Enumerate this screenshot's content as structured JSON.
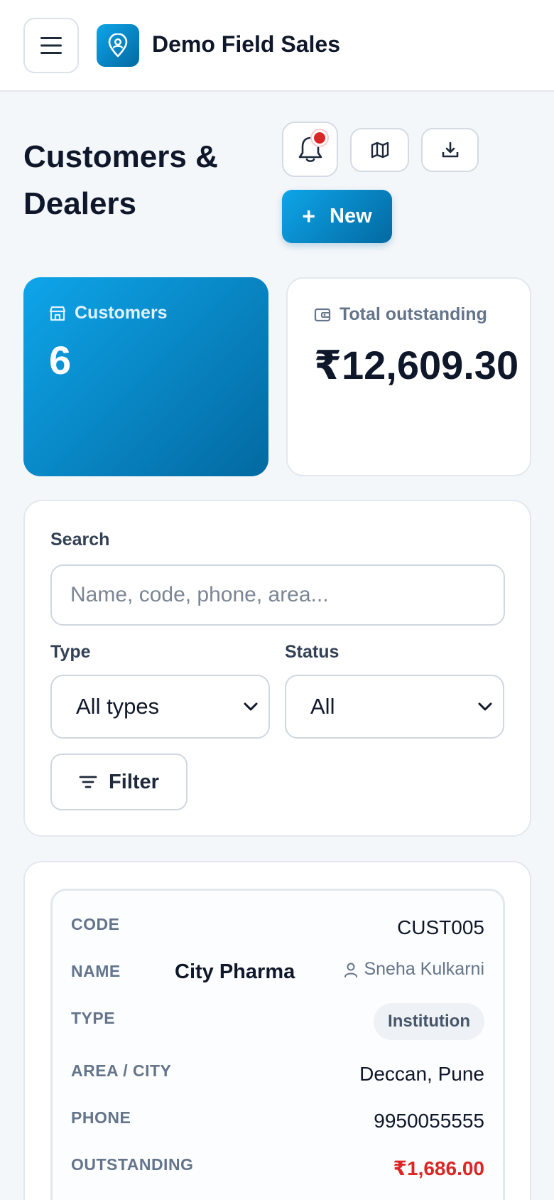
{
  "app": {
    "brand_name": "Demo Field Sales",
    "brand_icon": "map-pin-icon",
    "accent_color": "#0284c7"
  },
  "header": {
    "title": "Customers & Dealers",
    "new_label": "New",
    "notification_badge_color": "#dc2626"
  },
  "stats": {
    "customers_label": "Customers",
    "customers_value": "6",
    "outstanding_label": "Total outstanding",
    "outstanding_value": "₹12,609.30"
  },
  "filters": {
    "search_label": "Search",
    "search_placeholder": "Name, code, phone, area...",
    "type_label": "Type",
    "type_value": "All types",
    "status_label": "Status",
    "status_value": "All",
    "filter_label": "Filter"
  },
  "customer": {
    "labels": {
      "code": "CODE",
      "name": "NAME",
      "type": "TYPE",
      "area_city": "AREA / CITY",
      "phone": "PHONE",
      "outstanding": "OUTSTANDING"
    },
    "code": "CUST005",
    "name": "City Pharma",
    "owner": "Sneha Kulkarni",
    "type": "Institution",
    "area_city": "Deccan, Pune",
    "phone": "9950055555",
    "outstanding": "₹1,686.00"
  }
}
